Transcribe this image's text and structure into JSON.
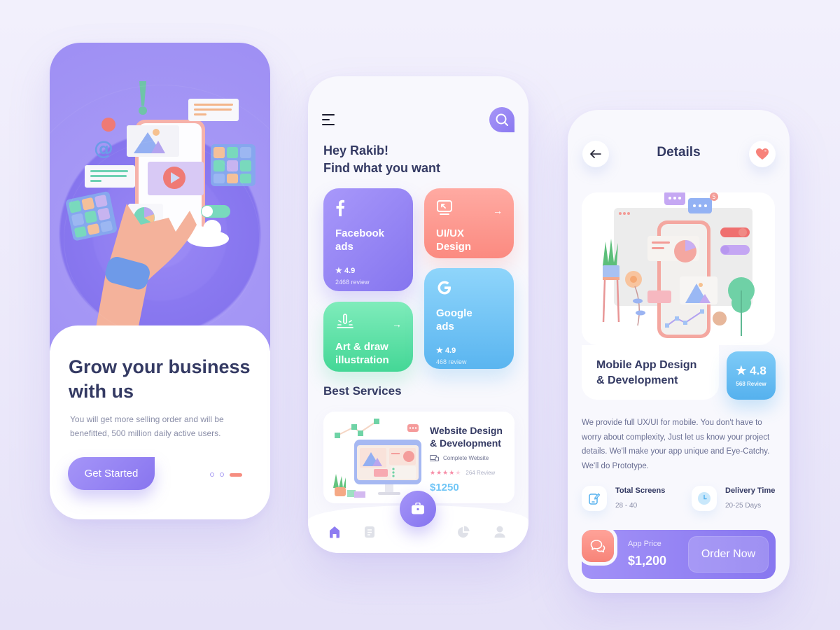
{
  "onboarding": {
    "title": "Grow your business with us",
    "description": "You will get more selling order and will be benefitted, 500 million daily active users.",
    "cta_label": "Get Started",
    "page_indicator": {
      "total": 3,
      "active_index": 2
    }
  },
  "home": {
    "greeting_line1": "Hey Rakib!",
    "greeting_line2": "Find what you want",
    "categories": [
      {
        "id": "facebook-ads",
        "icon": "facebook-icon",
        "name_line1": "Facebook",
        "name_line2": "ads",
        "rating": "4.9",
        "reviews": "2468 review",
        "color": "#9585f4"
      },
      {
        "id": "ui-ux-design",
        "icon": "monitor-cursor-icon",
        "name_line1": "UI/UX",
        "name_line2": "Design",
        "arrow": "→",
        "color": "#fc958b"
      },
      {
        "id": "art-draw",
        "icon": "pen-sparkle-icon",
        "name_line1": "Art & draw",
        "name_line2": "illustration",
        "arrow": "→",
        "color": "#5ddea5"
      },
      {
        "id": "google-ads",
        "icon": "google-icon",
        "name_line1": "Google",
        "name_line2": "ads",
        "rating": "4.9",
        "reviews": "468 review",
        "color": "#6dc0f3"
      }
    ],
    "best_services_title": "Best Services",
    "service": {
      "title_line1": "Website Design",
      "title_line2": "& Development",
      "subtitle": "Complete Website",
      "stars": 4,
      "max_stars": 5,
      "reviews": "264 Review",
      "price": "$1250"
    },
    "nav": [
      {
        "id": "home",
        "icon": "home-icon",
        "active": true
      },
      {
        "id": "documents",
        "icon": "document-icon",
        "active": false
      },
      {
        "id": "portfolio",
        "icon": "briefcase-icon",
        "active": false
      },
      {
        "id": "stats",
        "icon": "pie-chart-icon",
        "active": false
      },
      {
        "id": "profile",
        "icon": "user-icon",
        "active": false
      }
    ]
  },
  "details": {
    "title": "Details",
    "product_line1": "Mobile App Design",
    "product_line2": "& Development",
    "rating": "4.8",
    "reviews": "568 Review",
    "notification_count": "5",
    "description": "We provide full UX/UI for mobile. You don't have to worry about complexity, Just let us know your project details. We'll make your app unique and Eye-Catchy. We'll do Prototype.",
    "meta": [
      {
        "label": "Total Screens",
        "value": "28 - 40",
        "icon": "tablet-edit-icon"
      },
      {
        "label": "Delivery Time",
        "value": "20-25 Days",
        "icon": "clock-icon"
      }
    ],
    "price_label": "App Price",
    "price": "$1,200",
    "order_label": "Order Now"
  },
  "colors": {
    "primary": "#8d7cf1",
    "heading": "#343a63",
    "coral": "#f88b80",
    "sky": "#5ab5f0",
    "mint": "#44d796"
  }
}
